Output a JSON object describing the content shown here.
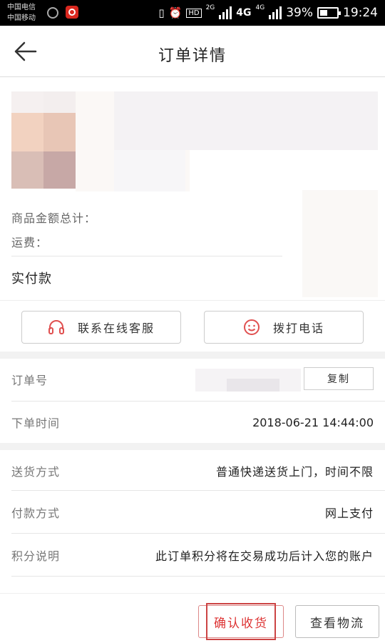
{
  "status_bar": {
    "carrier1": "中国电信",
    "carrier2": "中国移动",
    "hd": "HD",
    "net1": "2G",
    "net2": "4G",
    "net3": "4G",
    "battery": "39%",
    "time": "19:24"
  },
  "header": {
    "title": "订单详情"
  },
  "product": {
    "total_label": "商品金额总计：",
    "shipping_label": "运费：",
    "paid_label": "实付款"
  },
  "contact": {
    "online_service": "联系在线客服",
    "call_phone": "拨打电话"
  },
  "order": {
    "number_label": "订单号",
    "copy_label": "复制",
    "time_label": "下单时间",
    "time_value": "2018-06-21 14:44:00"
  },
  "delivery": {
    "method_label": "送货方式",
    "method_value": "普通快递送货上门，时间不限",
    "payment_label": "付款方式",
    "payment_value": "网上支付",
    "points_label": "积分说明",
    "points_value": "此订单积分将在交易成功后计入您的账户"
  },
  "bottom": {
    "confirm_label": "确认收货",
    "logistics_label": "查看物流"
  },
  "colors": {
    "accent_red": "#d33333",
    "highlight_box": "#c44444"
  }
}
